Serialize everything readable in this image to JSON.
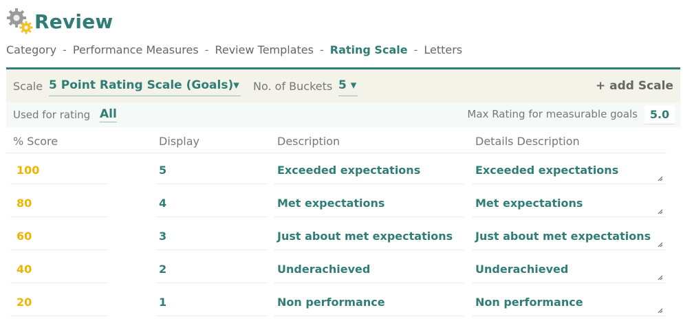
{
  "header": {
    "title": "Review",
    "icon": "gears-icon"
  },
  "nav": {
    "items": [
      {
        "label": "Category",
        "active": false
      },
      {
        "label": "Performance Measures",
        "active": false
      },
      {
        "label": "Review Templates",
        "active": false
      },
      {
        "label": "Rating Scale",
        "active": true
      },
      {
        "label": "Letters",
        "active": false
      }
    ],
    "separator": "-"
  },
  "scale_bar": {
    "scale_label": "Scale",
    "scale_value": "5 Point Rating Scale (Goals)▾",
    "buckets_label": "No. of Buckets",
    "buckets_value": "5 ▾",
    "add_scale": "+ add Scale"
  },
  "used_bar": {
    "used_label": "Used for rating",
    "used_value": "All",
    "max_label": "Max Rating for measurable goals",
    "max_value": "5.0"
  },
  "table": {
    "columns": [
      "% Score",
      "Display",
      "Description",
      "Details Description"
    ],
    "rows": [
      {
        "score": "100",
        "display": "5",
        "description": "Exceeded expectations",
        "details": "Exceeded expectations"
      },
      {
        "score": "80",
        "display": "4",
        "description": "Met expectations",
        "details": "Met expectations"
      },
      {
        "score": "60",
        "display": "3",
        "description": "Just about met expectations",
        "details": "Just about met expectations"
      },
      {
        "score": "40",
        "display": "2",
        "description": "Underachieved",
        "details": "Underachieved"
      },
      {
        "score": "20",
        "display": "1",
        "description": "Non performance",
        "details": "Non performance"
      }
    ]
  },
  "colors": {
    "accent": "#2f7d74",
    "score": "#f0b400",
    "muted": "#777777"
  }
}
